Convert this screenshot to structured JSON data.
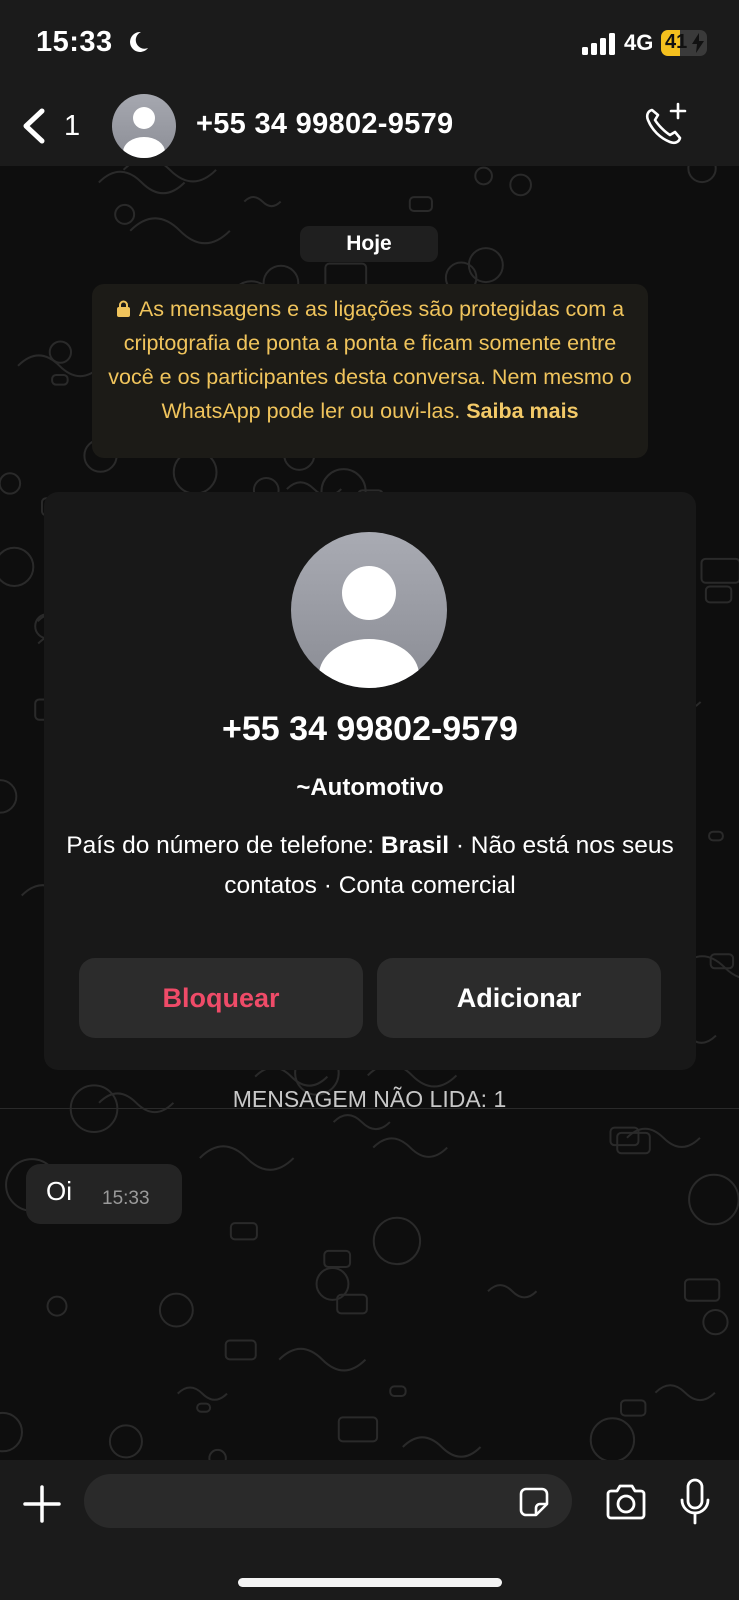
{
  "status_bar": {
    "time": "15:33",
    "network": "4G",
    "battery_percent": 41,
    "battery_label": "41"
  },
  "header": {
    "back_count": "1",
    "title": "+55 34 99802-9579"
  },
  "chat": {
    "date_label": "Hoje",
    "encryption_notice": "As mensagens e as ligações são protegidas com a criptografia de ponta a ponta e ficam somente entre você e os participantes desta conversa. Nem mesmo o WhatsApp pode ler ou ouvi-las.",
    "encryption_link": "Saiba mais",
    "contact_card": {
      "phone": "+55 34 99802-9579",
      "name": "~Automotivo",
      "country_label": "País do número de telefone:",
      "country": "Brasil",
      "not_in_contacts": "Não está nos seus contatos",
      "account_type": "Conta comercial",
      "separator": "·",
      "block_label": "Bloquear",
      "add_label": "Adicionar"
    },
    "unread_label": "MENSAGEM NÃO LIDA: 1",
    "messages": [
      {
        "text": "Oi",
        "time": "15:33"
      }
    ]
  },
  "input_bar": {
    "value": ""
  },
  "colors": {
    "background": "#0b0b0b",
    "bar": "#1b1b1b",
    "card": "#181818",
    "button": "#2c2c2c",
    "block_red": "#ef4b68",
    "notice_yellow": "#f0c45c",
    "battery_yellow": "#f4c01e"
  }
}
